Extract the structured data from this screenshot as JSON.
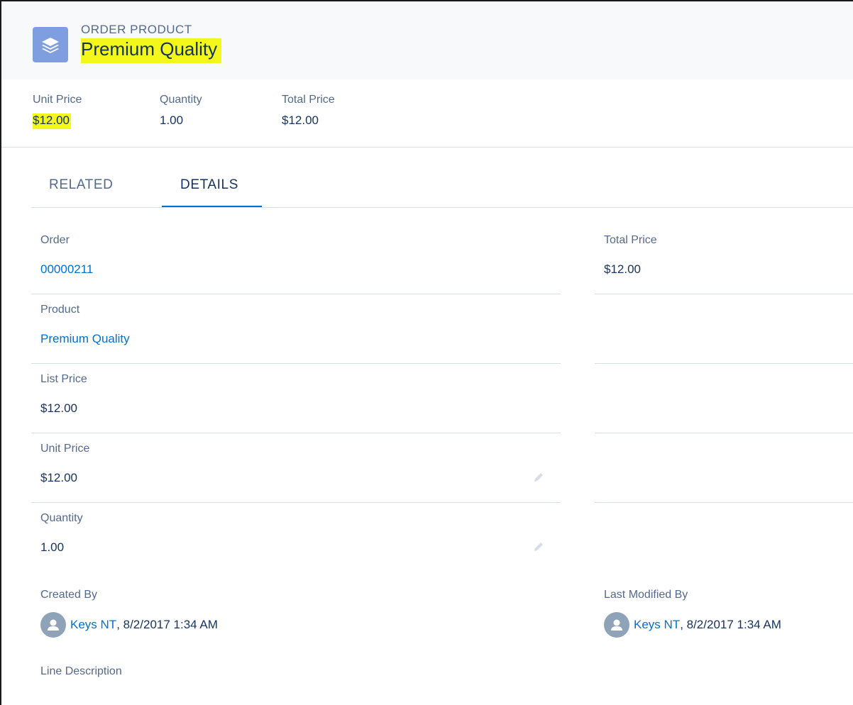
{
  "header": {
    "object_type": "ORDER PRODUCT",
    "title": "Premium Quality",
    "icon": "layers-icon",
    "highlight_color": "#f4f71a",
    "fields": [
      {
        "label": "Unit Price",
        "value": "$12.00"
      },
      {
        "label": "Quantity",
        "value": "1.00"
      },
      {
        "label": "Total Price",
        "value": "$12.00"
      }
    ]
  },
  "tabs": [
    {
      "label": "RELATED",
      "active": false
    },
    {
      "label": "DETAILS",
      "active": true
    }
  ],
  "details": {
    "order": {
      "label": "Order",
      "value": "00000211"
    },
    "total_price": {
      "label": "Total Price",
      "value": "$12.00"
    },
    "product": {
      "label": "Product",
      "value": "Premium Quality"
    },
    "list_price": {
      "label": "List Price",
      "value": "$12.00"
    },
    "unit_price": {
      "label": "Unit Price",
      "value": "$12.00"
    },
    "quantity": {
      "label": "Quantity",
      "value": "1.00"
    },
    "created_by": {
      "label": "Created By",
      "user": "Keys NT",
      "date": ", 8/2/2017 1:34 AM"
    },
    "last_modified_by": {
      "label": "Last Modified By",
      "user": "Keys NT",
      "date": ", 8/2/2017 1:34 AM"
    },
    "line_description": {
      "label": "Line Description"
    }
  },
  "colors": {
    "brand": "#0070d2",
    "text": "#16325c",
    "muted": "#54698d",
    "icon_bg": "#7f9ee0"
  }
}
